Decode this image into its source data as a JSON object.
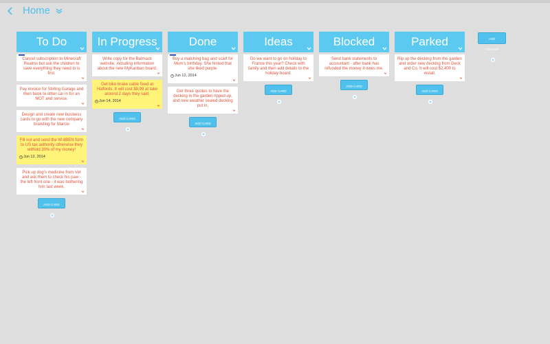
{
  "header": {
    "title": "Home"
  },
  "columns": [
    {
      "title": "To Do",
      "add_label": "ADD CARD",
      "cards": [
        {
          "text": "Cancel subscription to Minecraft Realms but ask the children to save everything they need to is first.",
          "color": "white",
          "bar": true
        },
        {
          "text": "Pay invoice for Stirling Garage and then book to other car in for an MOT and service.",
          "color": "white"
        },
        {
          "text": "Design and create new business cards to go with the new company branding for Marcie",
          "color": "white"
        },
        {
          "text": "Fill out and send the W-8BEN form to US tax authority otherwise they withold 30% of my money!",
          "color": "yellow",
          "date": "Jun 12, 2014"
        },
        {
          "text": "Pick up dog's medicine from Vet and ask them to check his paw - the left front one - it was bothering him last week.",
          "color": "white"
        }
      ]
    },
    {
      "title": "In Progress",
      "add_label": "ADD CARD",
      "cards": [
        {
          "text": "Write copy for the Batmack website, including information about the new MyKanban board.",
          "color": "white"
        },
        {
          "text": "Get bike brake cable fixed at Halfords. It will cost $9.99 at take around 2 days they said.",
          "color": "yellow",
          "date": "Jun 14, 2014"
        }
      ]
    },
    {
      "title": "Done",
      "add_label": "ADD CARD",
      "cards": [
        {
          "text": "Buy a matching bag and scarf for Mum's birthday. She hinted that she liked purple.",
          "color": "white",
          "bar": true,
          "date": "Jun 12, 2014"
        },
        {
          "text": "Get three quotes to have the decking in the garden ripped up, and new weather sealed decking put in.",
          "color": "white"
        }
      ]
    },
    {
      "title": "Ideas",
      "add_label": "ADD CARD",
      "cards": [
        {
          "text": "Do we want to go on holiday to France this year? Check with family and then add details to the holiday board.",
          "color": "white"
        }
      ]
    },
    {
      "title": "Blocked",
      "add_label": "ADD CARD",
      "cards": [
        {
          "text": "Send bank statements to accountant - after bank has refunded the money it owes me.",
          "color": "white"
        }
      ]
    },
    {
      "title": "Parked",
      "add_label": "ADD CARD",
      "cards": [
        {
          "text": "Rip up the decking from the garden and order new decking from Deck and Co. It will cost $2,400 to install.",
          "color": "white"
        }
      ]
    }
  ],
  "add_column_label": "ADD COLUMN",
  "colors": {
    "accent": "#5ccaf0",
    "card_text": "#e0533b",
    "yellow_card": "#fff37a",
    "background": "#dedede"
  }
}
